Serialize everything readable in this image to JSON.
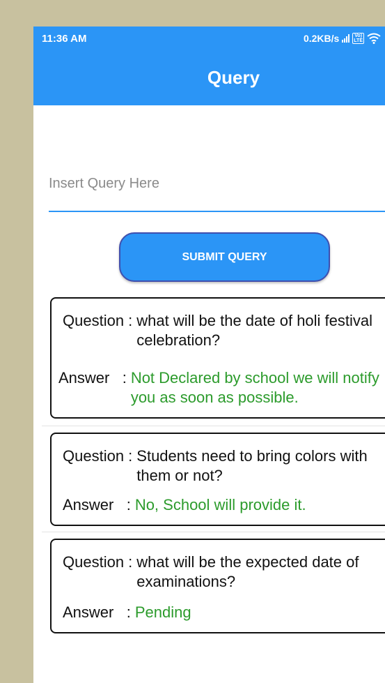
{
  "status_bar": {
    "time": "11:36 AM",
    "net_speed": "0.2KB/s",
    "volte_line1": "Vo)",
    "volte_line2": "LTE"
  },
  "appbar": {
    "title": "Query"
  },
  "query_input": {
    "placeholder": "Insert Query Here",
    "value": ""
  },
  "submit": {
    "label": "SUBMIT QUERY"
  },
  "queries": [
    {
      "question_label": "Question :",
      "question": "what will be the date of holi festival celebration?",
      "answer_label": "Answer   :",
      "answer": "Not Declared by school we will notify you as soon as possible."
    },
    {
      "question_label": "Question :",
      "question": "Students need to bring colors with them or not?",
      "answer_label": "Answer   :",
      "answer": "No, School will provide it."
    },
    {
      "question_label": "Question :",
      "question": "what will be the expected date of examinations?",
      "answer_label": "Answer   :",
      "answer": "Pending"
    }
  ],
  "colors": {
    "primary": "#2b95f6",
    "answer_text": "#2c9b2c",
    "background": "#c8c19f"
  },
  "icons": [
    "signal-icon",
    "volte-icon",
    "wifi-icon"
  ]
}
